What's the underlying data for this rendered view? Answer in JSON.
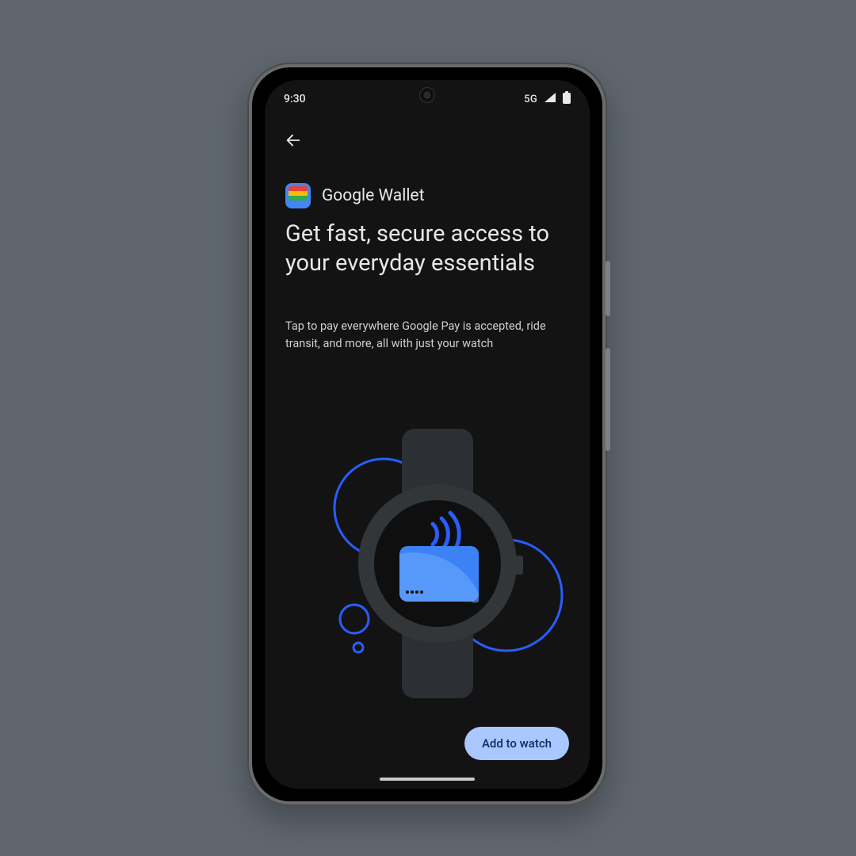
{
  "status": {
    "time": "9:30",
    "network_label": "5G"
  },
  "app": {
    "name": "Google Wallet"
  },
  "heading": "Get fast, secure access to your everyday essentials",
  "subheading": "Tap to pay everywhere Google Pay is accepted, ride transit, and more, all with just your watch",
  "cta": {
    "label": "Add to watch"
  },
  "colors": {
    "cta_bg": "#aac7ff",
    "cta_fg": "#0a2f64",
    "accent_blue": "#4285f4"
  }
}
